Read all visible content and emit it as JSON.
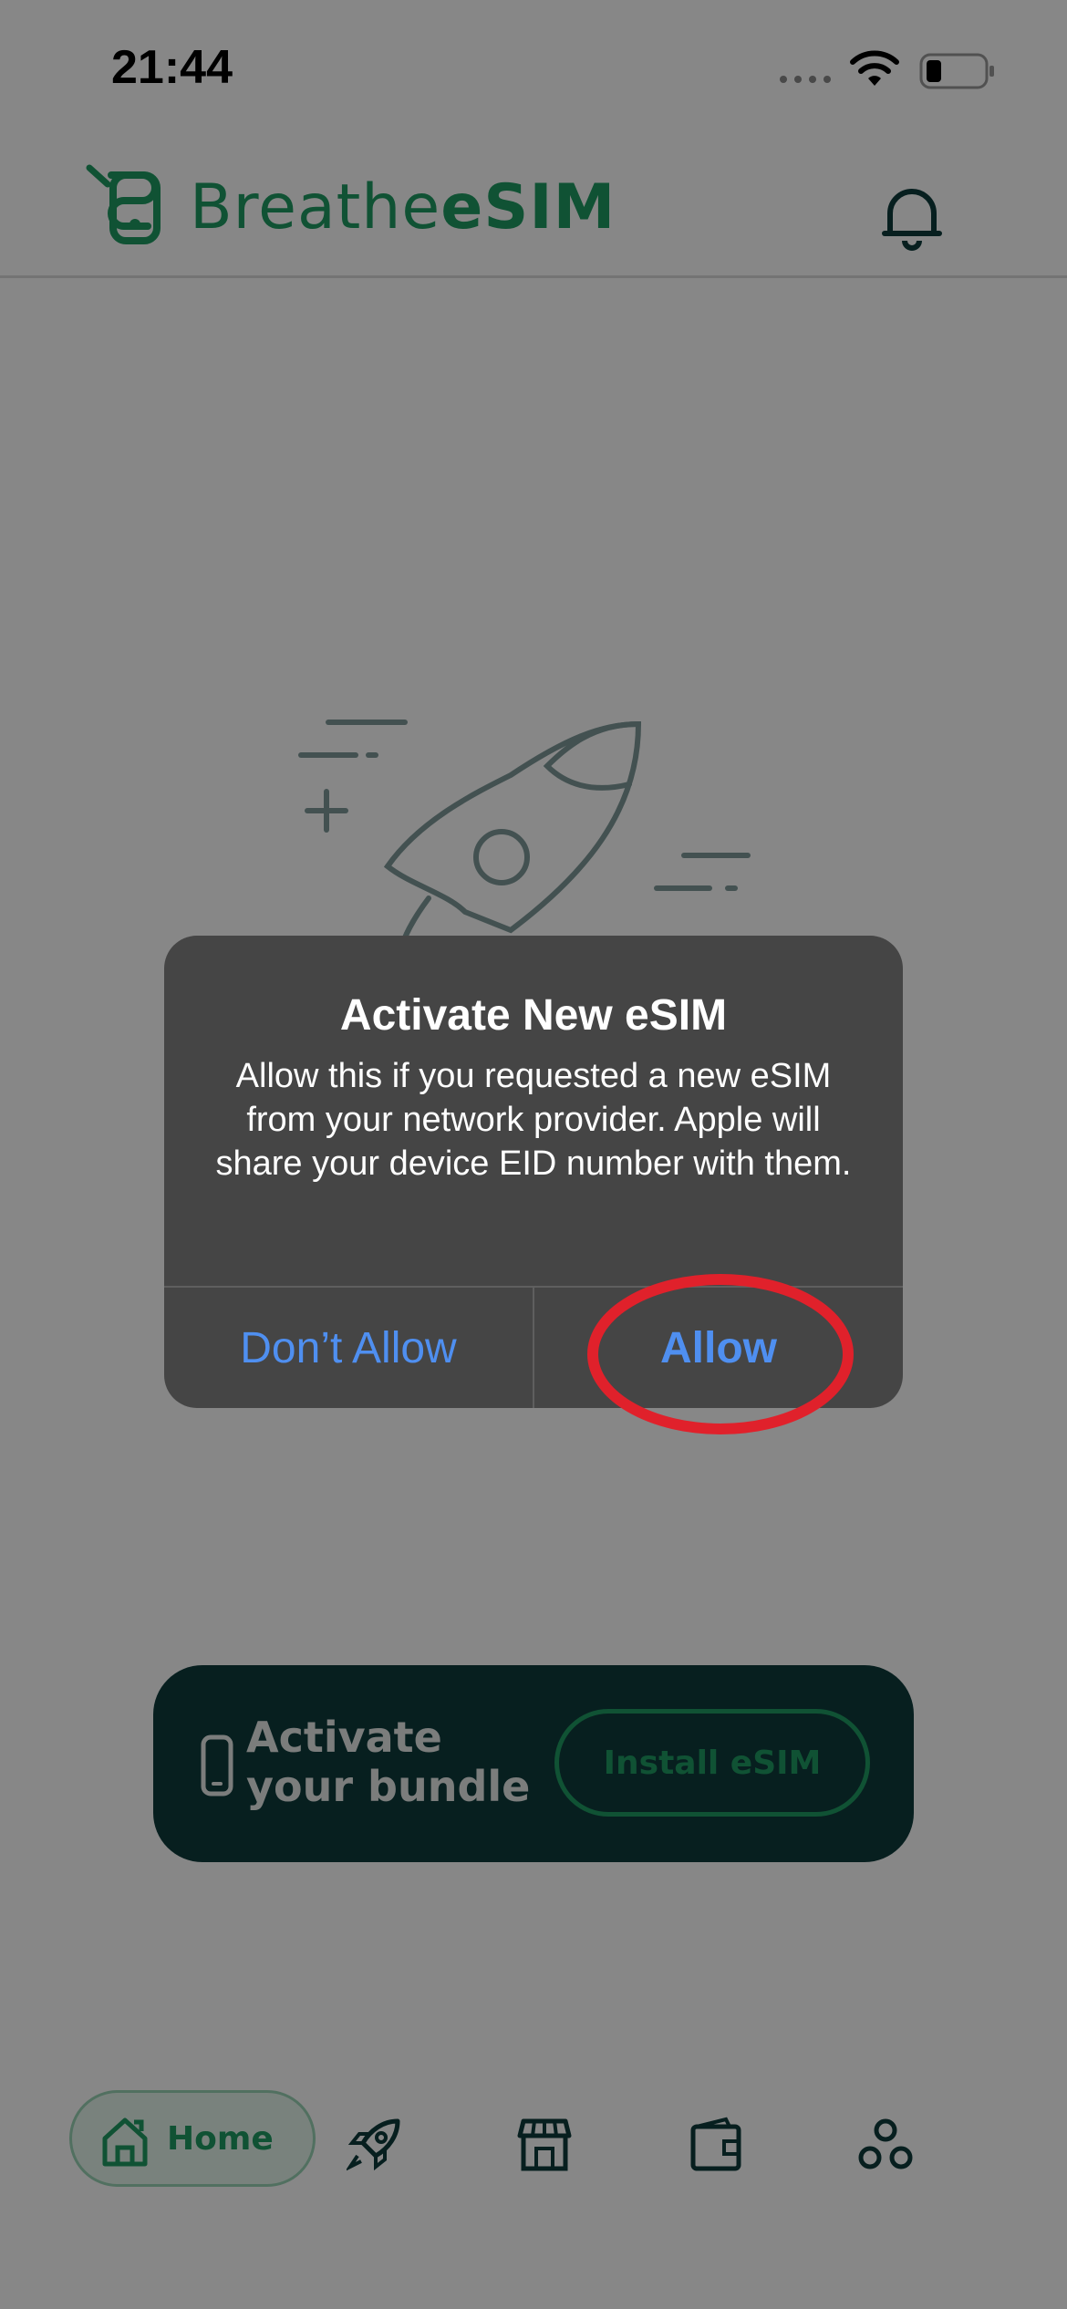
{
  "status_bar": {
    "time": "21:44",
    "icons": [
      "cellular-dots-icon",
      "wifi-icon",
      "battery-icon"
    ]
  },
  "header": {
    "logo_light": "Breathe",
    "logo_bold": "eSIM",
    "brand_color": "#1f9b62",
    "icons": [
      "logo-mark-icon",
      "bell-icon"
    ]
  },
  "illustration": {
    "icon": "rocket-icon"
  },
  "activate_card": {
    "title": "Activate your bundle",
    "button_label": "Install eSIM",
    "background_color": "#0e3b3c",
    "icon": "phone-icon"
  },
  "bottom_nav": {
    "items": [
      {
        "label": "Home",
        "icon": "home-icon",
        "active": true
      },
      {
        "label": "",
        "icon": "rocket-icon",
        "active": false
      },
      {
        "label": "",
        "icon": "store-icon",
        "active": false
      },
      {
        "label": "",
        "icon": "wallet-icon",
        "active": false
      },
      {
        "label": "",
        "icon": "community-icon",
        "active": false
      }
    ]
  },
  "alert": {
    "title": "Activate New eSIM",
    "message": "Allow this if you requested a new eSIM from your network provider. Apple will share your device EID number with them.",
    "dont_allow_label": "Don’t Allow",
    "allow_label": "Allow",
    "button_color": "#4f8ff0",
    "highlight_color": "#e0212b",
    "highlighted_button": "Allow"
  }
}
